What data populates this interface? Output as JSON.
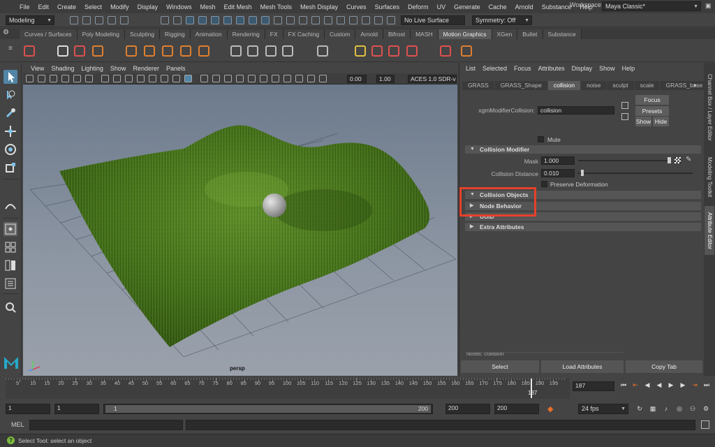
{
  "menubar": {
    "items": [
      "File",
      "Edit",
      "Create",
      "Select",
      "Modify",
      "Display",
      "Windows",
      "Mesh",
      "Edit Mesh",
      "Mesh Tools",
      "Mesh Display",
      "Curves",
      "Surfaces",
      "Deform",
      "UV",
      "Generate",
      "Cache",
      "Arnold",
      "Substance",
      "Help"
    ],
    "workspace_label": "Workspace:",
    "workspace_value": "Maya Classic*"
  },
  "statusline": {
    "menuset": "Modeling",
    "live_surface": "No Live Surface",
    "symmetry": "Symmetry: Off"
  },
  "shelf": {
    "tabs": [
      "Curves / Surfaces",
      "Poly Modeling",
      "Sculpting",
      "Rigging",
      "Animation",
      "Rendering",
      "FX",
      "FX Caching",
      "Custom",
      "Arnold",
      "Bifrost",
      "MASH",
      "Motion Graphics",
      "XGen",
      "Bullet",
      "Substance"
    ],
    "active_tab": "Motion Graphics"
  },
  "viewport": {
    "menus": [
      "View",
      "Shading",
      "Lighting",
      "Show",
      "Renderer",
      "Panels"
    ],
    "exposure": "0.00",
    "gamma": "1.00",
    "color_space": "ACES 1.0 SDR-vid",
    "camera_label": "persp"
  },
  "attribute_editor": {
    "menus": [
      "List",
      "Selected",
      "Focus",
      "Attributes",
      "Display",
      "Show",
      "Help"
    ],
    "tabs": [
      "GRASS",
      "GRASS_Shape",
      "collision",
      "noise",
      "sculpt",
      "scale",
      "GRASS_base"
    ],
    "active_tab": "collision",
    "node_label": "xgmModifierCollision:",
    "node_name": "collision",
    "focus_btn": "Focus",
    "presets_btn": "Presets",
    "show_btn": "Show",
    "hide_btn": "Hide",
    "mute_label": "Mute",
    "sections": {
      "collision_modifier": "Collision Modifier",
      "collision_objects": "Collision Objects",
      "node_behavior": "Node Behavior",
      "uuid": "UUID",
      "extra_attributes": "Extra Attributes"
    },
    "fields": {
      "mask_label": "Mask",
      "mask_value": "1.000",
      "distance_label": "Collision Distance",
      "distance_value": "0.010",
      "preserve_label": "Preserve Deformation"
    },
    "notes_label": "Notes: collision",
    "footer": {
      "select": "Select",
      "load": "Load Attributes",
      "copy": "Copy Tab"
    }
  },
  "sidetabs": [
    "Channel Box / Layer Editor",
    "Modeling Toolkit",
    "Attribute Editor"
  ],
  "timeline": {
    "ticks": [
      "5",
      "10",
      "15",
      "20",
      "25",
      "30",
      "35",
      "40",
      "45",
      "50",
      "55",
      "60",
      "65",
      "70",
      "75",
      "80",
      "85",
      "90",
      "95",
      "100",
      "105",
      "110",
      "115",
      "120",
      "125",
      "130",
      "135",
      "140",
      "145",
      "150",
      "155",
      "160",
      "165",
      "170",
      "175",
      "180",
      "185",
      "190",
      "195"
    ],
    "current_frame": "187",
    "current_frame_field": "187"
  },
  "range": {
    "start": "1",
    "anim_start": "1",
    "slider_start": "1",
    "slider_end": "200",
    "end": "200",
    "anim_end": "200",
    "fps": "24 fps"
  },
  "cmdline": {
    "label": "MEL"
  },
  "helpline": {
    "text": "Select Tool: select an object"
  },
  "colors": {
    "highlight": "#e8402a",
    "accent": "#5285a6",
    "grass": "#4b7a1f"
  }
}
